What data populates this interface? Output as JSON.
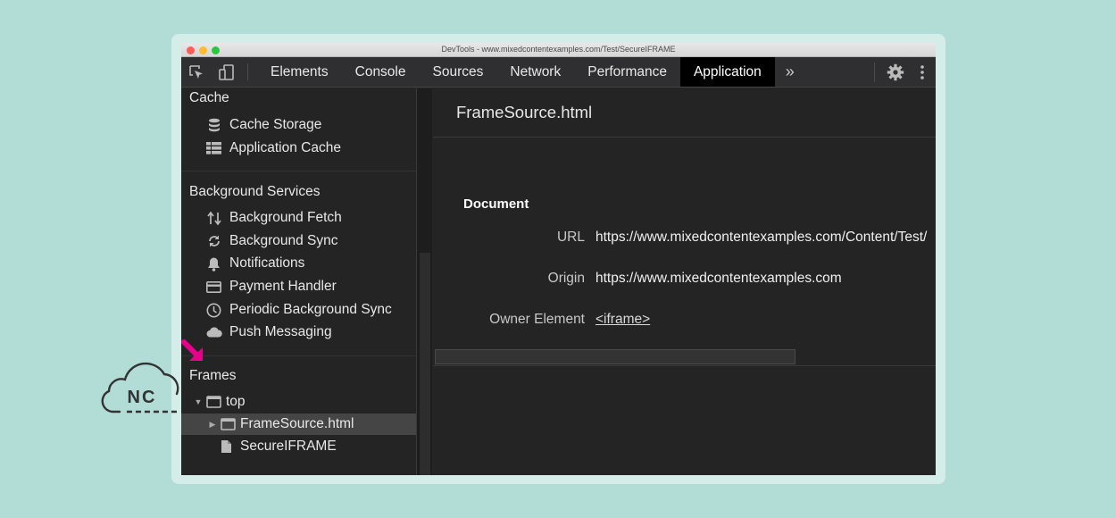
{
  "window": {
    "title": "DevTools - www.mixedcontentexamples.com/Test/SecureIFRAME"
  },
  "toolbar": {
    "tabs": [
      "Elements",
      "Console",
      "Sources",
      "Network",
      "Performance",
      "Application"
    ],
    "active_tab": "Application",
    "more_symbol": "»"
  },
  "sidebar": {
    "cache_section": {
      "heading": "Cache",
      "items": [
        {
          "label": "Cache Storage",
          "icon": "database-icon"
        },
        {
          "label": "Application Cache",
          "icon": "grid-icon"
        }
      ]
    },
    "background_section": {
      "heading": "Background Services",
      "items": [
        {
          "label": "Background Fetch",
          "icon": "up-down-arrows-icon"
        },
        {
          "label": "Background Sync",
          "icon": "sync-icon"
        },
        {
          "label": "Notifications",
          "icon": "bell-icon"
        },
        {
          "label": "Payment Handler",
          "icon": "credit-card-icon"
        },
        {
          "label": "Periodic Background Sync",
          "icon": "clock-icon"
        },
        {
          "label": "Push Messaging",
          "icon": "cloud-icon"
        }
      ]
    },
    "frames_section": {
      "heading": "Frames",
      "tree": [
        {
          "label": "top",
          "level": 0,
          "expanded": true
        },
        {
          "label": "FrameSource.html",
          "level": 1,
          "expanded": false,
          "selected": true
        },
        {
          "label": "SecureIFRAME",
          "level": 1
        }
      ]
    }
  },
  "main": {
    "title": "FrameSource.html",
    "document_heading": "Document",
    "rows": [
      {
        "label": "URL",
        "value": "https://www.mixedcontentexamples.com/Content/Test/"
      },
      {
        "label": "Origin",
        "value": "https://www.mixedcontentexamples.com"
      },
      {
        "label": "Owner Element",
        "value": "<iframe>"
      }
    ]
  },
  "logo": {
    "text": "NC"
  },
  "colors": {
    "background": "#b2ddd7",
    "pointer": "#e6008a",
    "active_tab": "#000000"
  }
}
